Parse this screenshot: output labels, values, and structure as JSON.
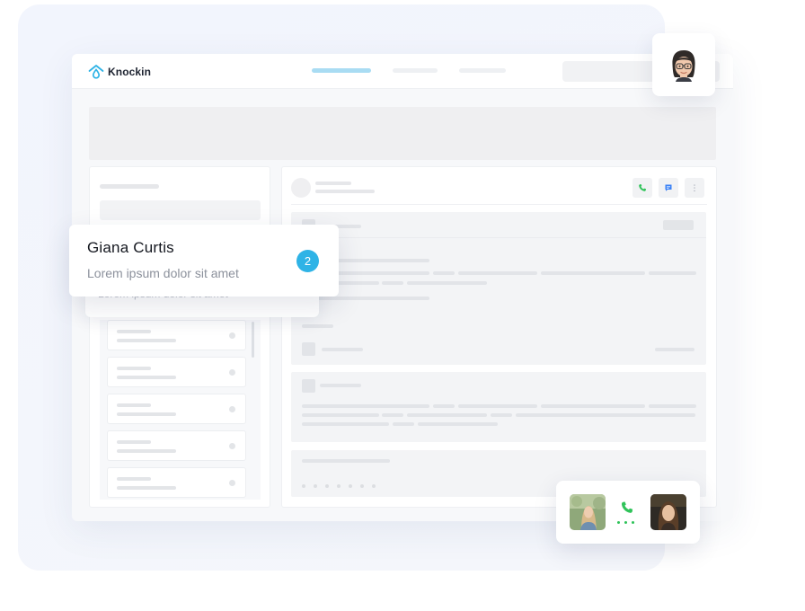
{
  "app": {
    "name": "Knockin",
    "brand_color": "#2eb3e6"
  },
  "notification": {
    "contact_name": "Giana Curtis",
    "message_preview": "Lorem ipsum dolor sit amet",
    "unread_count": "2"
  },
  "previous_notification": {
    "message_preview": "Lorem ipsum dolor sit amet"
  },
  "chat_header": {
    "more_label": "⋮"
  },
  "icons": {
    "logo": "house-drop-icon",
    "call": "phone-icon",
    "message": "chat-bubble-icon",
    "more": "vertical-dots-icon",
    "call_status": "phone-icon",
    "call_accent_color": "#30c35a"
  }
}
